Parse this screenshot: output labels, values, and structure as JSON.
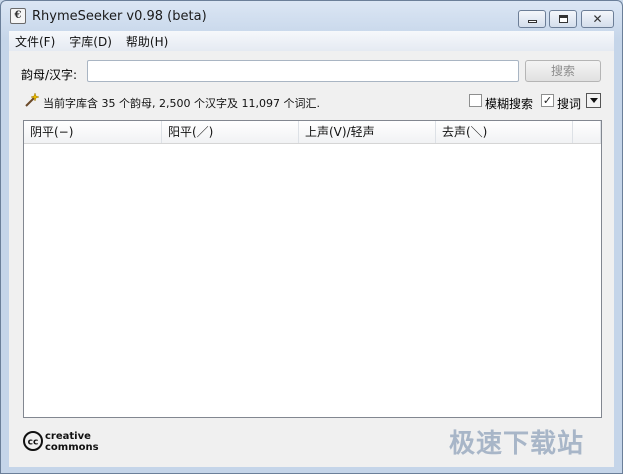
{
  "window": {
    "title": "RhymeSeeker v0.98 (beta)",
    "app_icon_glyph": "€"
  },
  "menu": [
    {
      "label": "文件(F)"
    },
    {
      "label": "字库(D)"
    },
    {
      "label": "帮助(H)"
    }
  ],
  "search": {
    "label": "韵母/汉字:",
    "value": "",
    "placeholder": "",
    "button_label": "搜索"
  },
  "status": {
    "icon": "magic-wand-icon",
    "text": "当前字库含 35 个韵母, 2,500 个汉字及 11,097 个词汇."
  },
  "options": {
    "fuzzy": {
      "label": "模糊搜索",
      "checked": false
    },
    "word": {
      "label": "搜词",
      "checked": true,
      "mark": "✓"
    }
  },
  "table": {
    "columns": [
      "阴平(−)",
      "阳平(／)",
      "上声(V)/轻声",
      "去声(＼)"
    ],
    "rows": []
  },
  "footer": {
    "logo_text": "creative commons",
    "watermark": "极速下载站"
  },
  "colors": {
    "titlebar": "#c5d5e9",
    "client": "#f0f0f0",
    "disabled_text": "#8d8d8d"
  }
}
